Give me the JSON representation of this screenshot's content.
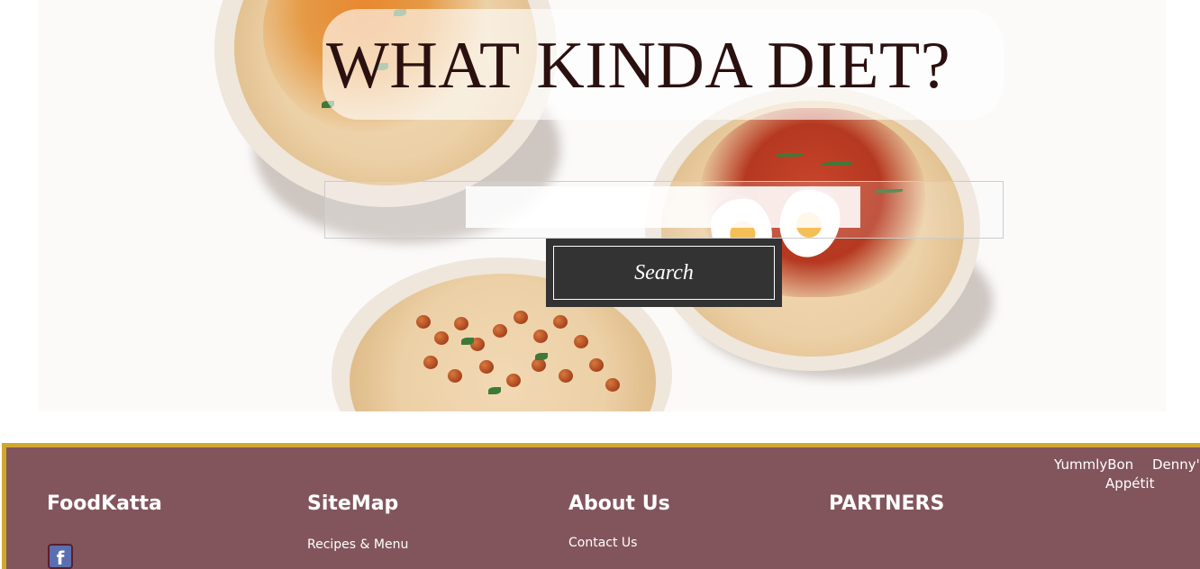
{
  "hero": {
    "title": "WHAT KINDA DIET?",
    "search": {
      "value": "",
      "placeholder": ""
    },
    "search_button_label": "Search"
  },
  "footer": {
    "columns": [
      {
        "heading": "FoodKatta",
        "links": []
      },
      {
        "heading": "SiteMap",
        "links": [
          "Recipes & Menu"
        ]
      },
      {
        "heading": "About Us",
        "links": [
          "Contact Us"
        ]
      },
      {
        "heading": "PARTNERS",
        "links": []
      }
    ],
    "partners": [
      "YummlyBon",
      "Denny's",
      "Appétit"
    ],
    "social_icon": "facebook-icon"
  },
  "colors": {
    "footer_bg": "#82555c",
    "footer_border": "#d2a72d",
    "button_bg": "#333333",
    "title_color": "#2b1010"
  }
}
